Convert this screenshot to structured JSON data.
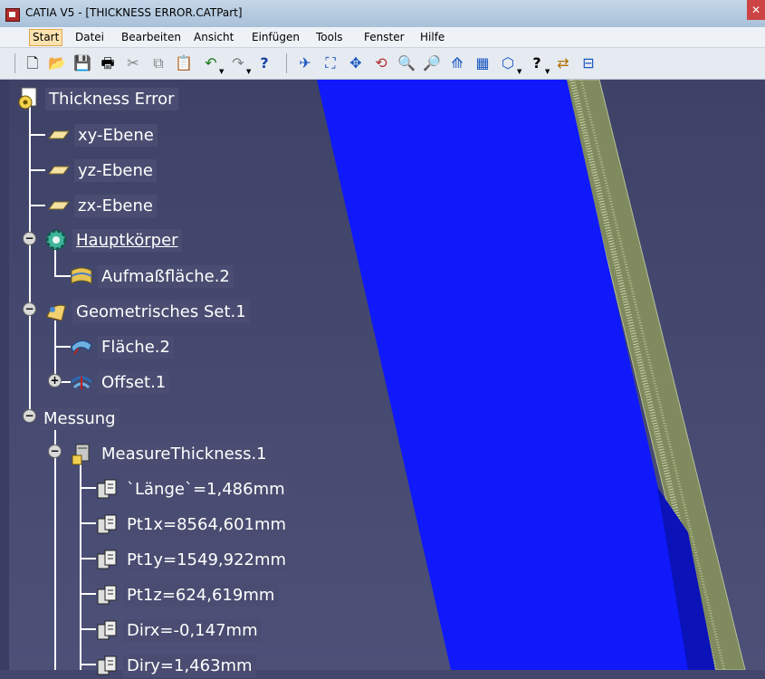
{
  "window": {
    "title": "CATIA V5 - [THICKNESS ERROR.CATPart]",
    "close_label": "✕"
  },
  "menu": [
    "Start",
    "Datei",
    "Bearbeiten",
    "Ansicht",
    "Einfügen",
    "Tools",
    "Fenster",
    "Hilfe"
  ],
  "toolbar": [
    {
      "name": "new-icon",
      "glyph": "🗋"
    },
    {
      "name": "open-icon",
      "glyph": "📂"
    },
    {
      "name": "save-icon",
      "glyph": "💾"
    },
    {
      "name": "print-icon",
      "glyph": "🖶"
    },
    {
      "name": "cut-icon",
      "glyph": "✂"
    },
    {
      "name": "copy-icon",
      "glyph": "⧉"
    },
    {
      "name": "paste-icon",
      "glyph": "📋"
    },
    {
      "name": "undo-icon",
      "glyph": "↶"
    },
    {
      "name": "redo-icon",
      "glyph": "↷"
    },
    {
      "name": "whats-this-icon",
      "glyph": "?"
    },
    {
      "name": "fly-mode-icon",
      "glyph": "✈"
    },
    {
      "name": "fit-all-icon",
      "glyph": "⛶"
    },
    {
      "name": "pan-icon",
      "glyph": "✥"
    },
    {
      "name": "rotate-icon",
      "glyph": "⟲"
    },
    {
      "name": "zoom-in-icon",
      "glyph": "🔍"
    },
    {
      "name": "zoom-out-icon",
      "glyph": "🔎"
    },
    {
      "name": "normal-view-icon",
      "glyph": "⟰"
    },
    {
      "name": "multi-view-icon",
      "glyph": "▦"
    },
    {
      "name": "iso-view-icon",
      "glyph": "⬡"
    },
    {
      "name": "hide-show-icon",
      "glyph": "?"
    },
    {
      "name": "swap-visible-icon",
      "glyph": "⇄"
    },
    {
      "name": "measure-icon",
      "glyph": "⊟"
    }
  ],
  "tree": {
    "root": "Thickness Error",
    "planes": [
      "xy-Ebene",
      "yz-Ebene",
      "zx-Ebene"
    ],
    "body": {
      "label": "Hauptkörper",
      "children": [
        "Aufmaßfläche.2"
      ]
    },
    "geoset": {
      "label": "Geometrisches Set.1",
      "children": [
        "Fläche.2",
        "Offset.1"
      ]
    },
    "measure": {
      "label": "Messung",
      "item": "MeasureThickness.1",
      "params": [
        "`Länge`=1,486mm",
        "Pt1x=8564,601mm",
        "Pt1y=1549,922mm",
        "Pt1z=624,619mm",
        "Dirx=-0,147mm",
        "Diry=1,463mm"
      ]
    }
  },
  "colors": {
    "background": "#43476b",
    "surface_blue": "#0f19fa",
    "offset_edge": "#8e9a6a"
  }
}
